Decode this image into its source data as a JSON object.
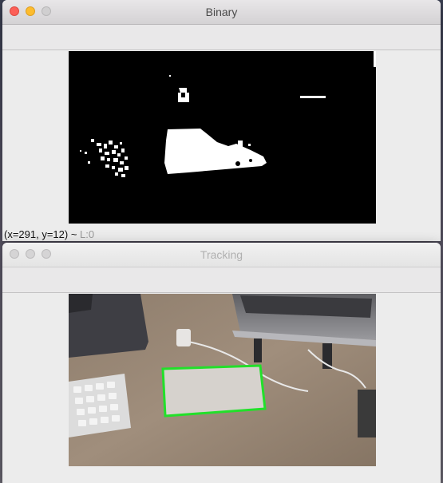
{
  "windows": {
    "binary": {
      "title": "Binary",
      "status": {
        "coords": "(x=291, y=12) ~ ",
        "level": "L:0"
      }
    },
    "tracking": {
      "title": "Tracking"
    }
  },
  "colors": {
    "tracking_box": "#22e02a",
    "close": "#fc5f57",
    "minimize": "#fdbc2e",
    "maximize": "#d0cfd0"
  }
}
